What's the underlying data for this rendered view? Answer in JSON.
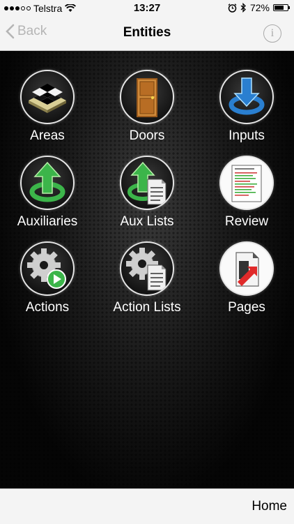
{
  "status_bar": {
    "carrier": "Telstra",
    "time": "13:27",
    "battery": "72%",
    "battery_level": 0.72
  },
  "nav": {
    "back_label": "Back",
    "title": "Entities",
    "info_label": "i"
  },
  "tiles": [
    {
      "label": "Areas",
      "icon": "areas-icon"
    },
    {
      "label": "Doors",
      "icon": "door-icon"
    },
    {
      "label": "Inputs",
      "icon": "inputs-icon"
    },
    {
      "label": "Auxiliaries",
      "icon": "auxiliaries-icon"
    },
    {
      "label": "Aux Lists",
      "icon": "aux-lists-icon"
    },
    {
      "label": "Review",
      "icon": "review-icon"
    },
    {
      "label": "Actions",
      "icon": "actions-icon"
    },
    {
      "label": "Action Lists",
      "icon": "action-lists-icon"
    },
    {
      "label": "Pages",
      "icon": "pages-icon"
    }
  ],
  "footer": {
    "home_label": "Home"
  },
  "colors": {
    "bar_bg": "#f4f4f4",
    "disabled": "#b5b5b5",
    "label": "#ffffff",
    "green": "#3cb54a",
    "blue": "#2a7fd0"
  }
}
